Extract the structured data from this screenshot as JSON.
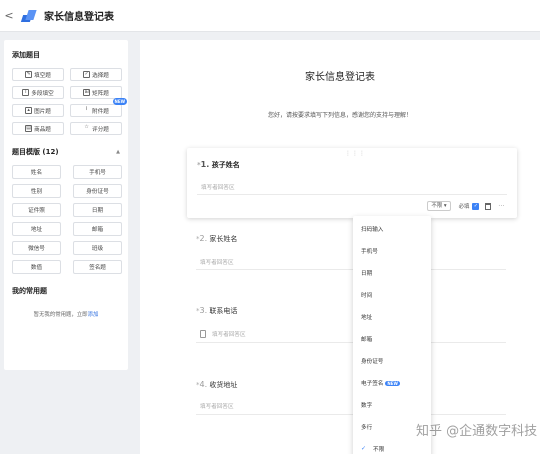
{
  "app": {
    "title": "家长信息登记表"
  },
  "sidebar": {
    "add_title": "添加题目",
    "add_items": [
      {
        "label": "填空题",
        "icon": "edit-icon"
      },
      {
        "label": "选择题",
        "icon": "checkbox-icon"
      },
      {
        "label": "多段填空",
        "icon": "multi-fill-icon"
      },
      {
        "label": "矩阵题",
        "icon": "matrix-icon"
      },
      {
        "label": "图片题",
        "icon": "image-icon"
      },
      {
        "label": "附件题",
        "icon": "paperclip-icon",
        "badge": "NEW"
      },
      {
        "label": "商品题",
        "icon": "product-icon"
      },
      {
        "label": "评分题",
        "icon": "star-icon"
      }
    ],
    "template_title": "题目模版 (12)",
    "template_items": [
      "姓名",
      "手机号",
      "性别",
      "身份证号",
      "证件照",
      "日期",
      "地址",
      "邮箱",
      "微信号",
      "班级",
      "数值",
      "签名题"
    ],
    "fav_title": "我的常用题",
    "fav_empty_text": "暂无我的常用题，立即",
    "fav_add_link": "添加"
  },
  "form": {
    "title": "家长信息登记表",
    "description": "您好，请按要求填写下列信息，感谢您的支持与理解！",
    "questions": [
      {
        "num": "1.",
        "label": "孩子姓名",
        "placeholder": "填写者回答区"
      },
      {
        "num": "2.",
        "label": "家长姓名",
        "placeholder": "填写者回答区"
      },
      {
        "num": "3.",
        "label": "联系电话",
        "placeholder": "填写者回答区"
      },
      {
        "num": "4.",
        "label": "收货地址",
        "placeholder": "填写者回答区"
      }
    ],
    "toolbar": {
      "type_select": "不限",
      "required_label": "必填",
      "more": "···"
    }
  },
  "dropdown": {
    "items": [
      "扫码输入",
      "手机号",
      "日期",
      "时间",
      "地址",
      "邮箱",
      "身份证号",
      "电子签名",
      "数字",
      "多行",
      "不限"
    ],
    "new_badge": "NEW",
    "selected": "不限"
  },
  "watermark": "知乎 @企通数字科技",
  "colors": {
    "accent": "#3b82f6",
    "background": "#eef0f3"
  }
}
